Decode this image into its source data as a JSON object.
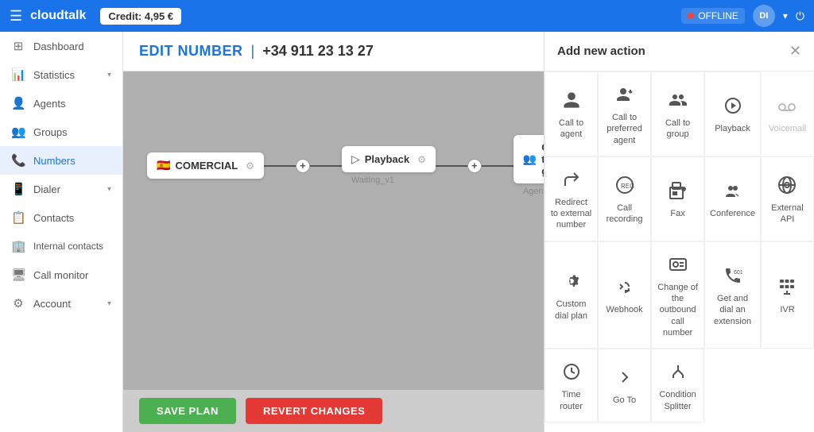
{
  "topbar": {
    "logo": "cloudtalk",
    "credit_label": "Credit: 4,95 €",
    "status": "OFFLINE",
    "avatar_initials": "DI",
    "chevron": "▾"
  },
  "sidebar": {
    "items": [
      {
        "id": "dashboard",
        "label": "Dashboard",
        "icon": "⊞"
      },
      {
        "id": "statistics",
        "label": "Statistics",
        "icon": "📊",
        "has_chevron": true
      },
      {
        "id": "agents",
        "label": "Agents",
        "icon": "👤"
      },
      {
        "id": "groups",
        "label": "Groups",
        "icon": "👥"
      },
      {
        "id": "numbers",
        "label": "Numbers",
        "icon": "📞",
        "active": true
      },
      {
        "id": "dialer",
        "label": "Dialer",
        "icon": "📱",
        "has_chevron": true
      },
      {
        "id": "contacts",
        "label": "Contacts",
        "icon": "📋"
      },
      {
        "id": "internal-contacts",
        "label": "Internal contacts",
        "icon": "🏢"
      },
      {
        "id": "call-monitor",
        "label": "Call monitor",
        "icon": "🖥"
      },
      {
        "id": "account",
        "label": "Account",
        "icon": "⚙",
        "has_chevron": true
      }
    ]
  },
  "page": {
    "title_label": "EDIT NUMBER",
    "divider": "|",
    "phone_number": "+34 911 23 13 27"
  },
  "flow": {
    "nodes": [
      {
        "id": "comercial",
        "label": "COMERCIAL",
        "flag": "🇪🇸"
      },
      {
        "id": "playback",
        "label": "Playback",
        "sub": "Waiting_v1"
      },
      {
        "id": "call-to-group",
        "label": "Call to group",
        "sub": "Agents"
      }
    ]
  },
  "bottom_bar": {
    "save_label": "SAVE PLAN",
    "revert_label": "REVERT CHANGES"
  },
  "panel": {
    "title": "Add new action",
    "close_icon": "✕",
    "actions": [
      {
        "id": "call-to-agent",
        "label": "Call to agent",
        "icon_type": "person"
      },
      {
        "id": "call-to-preferred-agent",
        "label": "Call to preferred agent",
        "icon_type": "person-forward"
      },
      {
        "id": "call-to-group",
        "label": "Call to group",
        "icon_type": "people"
      },
      {
        "id": "playback",
        "label": "Playback",
        "icon_type": "play"
      },
      {
        "id": "voicemail",
        "label": "Voicemail",
        "icon_type": "voicemail",
        "disabled": true
      },
      {
        "id": "redirect-to-external",
        "label": "Redirect to external number",
        "icon_type": "redirect"
      },
      {
        "id": "call-recording",
        "label": "Call recording",
        "icon_type": "recording"
      },
      {
        "id": "fax",
        "label": "Fax",
        "icon_type": "fax"
      },
      {
        "id": "conference",
        "label": "Conference",
        "icon_type": "conference"
      },
      {
        "id": "external-api",
        "label": "External API",
        "icon_type": "api"
      },
      {
        "id": "custom-dial-plan",
        "label": "Custom dial plan",
        "icon_type": "gear"
      },
      {
        "id": "webhook",
        "label": "Webhook",
        "icon_type": "webhook"
      },
      {
        "id": "change-outbound",
        "label": "Change of the outbound call number",
        "icon_type": "contact-card"
      },
      {
        "id": "get-and-dial",
        "label": "Get and dial an extension",
        "icon_type": "phone-ext"
      },
      {
        "id": "ivr",
        "label": "IVR",
        "icon_type": "ivr"
      },
      {
        "id": "time-router",
        "label": "Time router",
        "icon_type": "clock"
      },
      {
        "id": "go-to",
        "label": "Go To",
        "icon_type": "chevron-right"
      },
      {
        "id": "condition-splitter",
        "label": "Condition Splitter",
        "icon_type": "split"
      }
    ]
  }
}
